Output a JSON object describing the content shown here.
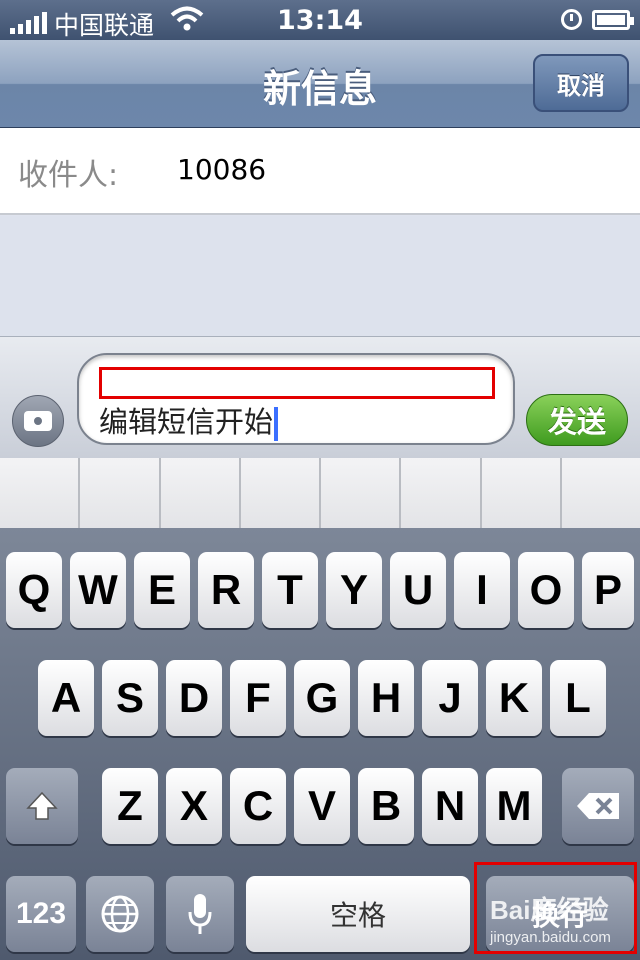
{
  "status_bar": {
    "carrier": "中国联通",
    "time": "13:14"
  },
  "nav": {
    "title": "新信息",
    "cancel_label": "取消"
  },
  "recipient": {
    "label": "收件人:",
    "value": "10086"
  },
  "compose": {
    "text": "编辑短信开始",
    "send_label": "发送"
  },
  "keyboard": {
    "row1": [
      "Q",
      "W",
      "E",
      "R",
      "T",
      "Y",
      "U",
      "I",
      "O",
      "P"
    ],
    "row2": [
      "A",
      "S",
      "D",
      "F",
      "G",
      "H",
      "J",
      "K",
      "L"
    ],
    "row3": [
      "Z",
      "X",
      "C",
      "V",
      "B",
      "N",
      "M"
    ],
    "num_label": "123",
    "space_label": "空格",
    "return_label": "换行"
  },
  "watermark": {
    "logo": "Bai度经验",
    "url": "jingyan.baidu.com"
  },
  "colors": {
    "nav_bar": "#7a92b4",
    "send_button": "#4ea82a",
    "highlight_box": "#e30000",
    "caret": "#3b6fff"
  }
}
